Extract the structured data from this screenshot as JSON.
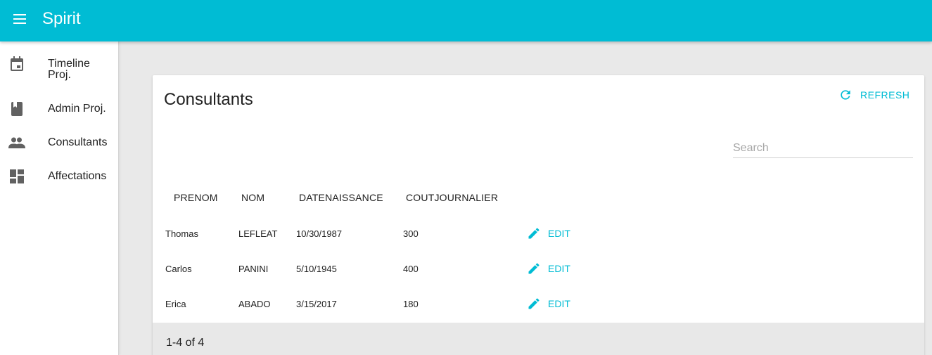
{
  "app": {
    "title": "Spirit"
  },
  "colors": {
    "primary": "#00bcd4",
    "background": "#e9e9e9"
  },
  "sidebar": {
    "items": [
      {
        "label": "Timeline Proj.",
        "icon": "calendar-icon"
      },
      {
        "label": "Admin Proj.",
        "icon": "book-icon"
      },
      {
        "label": "Consultants",
        "icon": "people-icon"
      },
      {
        "label": "Affectations",
        "icon": "dashboard-icon"
      }
    ]
  },
  "main": {
    "title": "Consultants",
    "refresh_label": "REFRESH",
    "search": {
      "placeholder": "Search",
      "value": ""
    },
    "table": {
      "columns": [
        "PRENOM",
        "NOM",
        "DATENAISSANCE",
        "COUTJOURNALIER"
      ],
      "edit_label": "EDIT",
      "rows": [
        {
          "prenom": "Thomas",
          "nom": "LEFLEAT",
          "datenaissance": "10/30/1987",
          "coutjournalier": "300"
        },
        {
          "prenom": "Carlos",
          "nom": "PANINI",
          "datenaissance": "5/10/1945",
          "coutjournalier": "400"
        },
        {
          "prenom": "Erica",
          "nom": "ABADO",
          "datenaissance": "3/15/2017",
          "coutjournalier": "180"
        }
      ]
    },
    "pagination": {
      "text": "1-4 of 4"
    }
  }
}
